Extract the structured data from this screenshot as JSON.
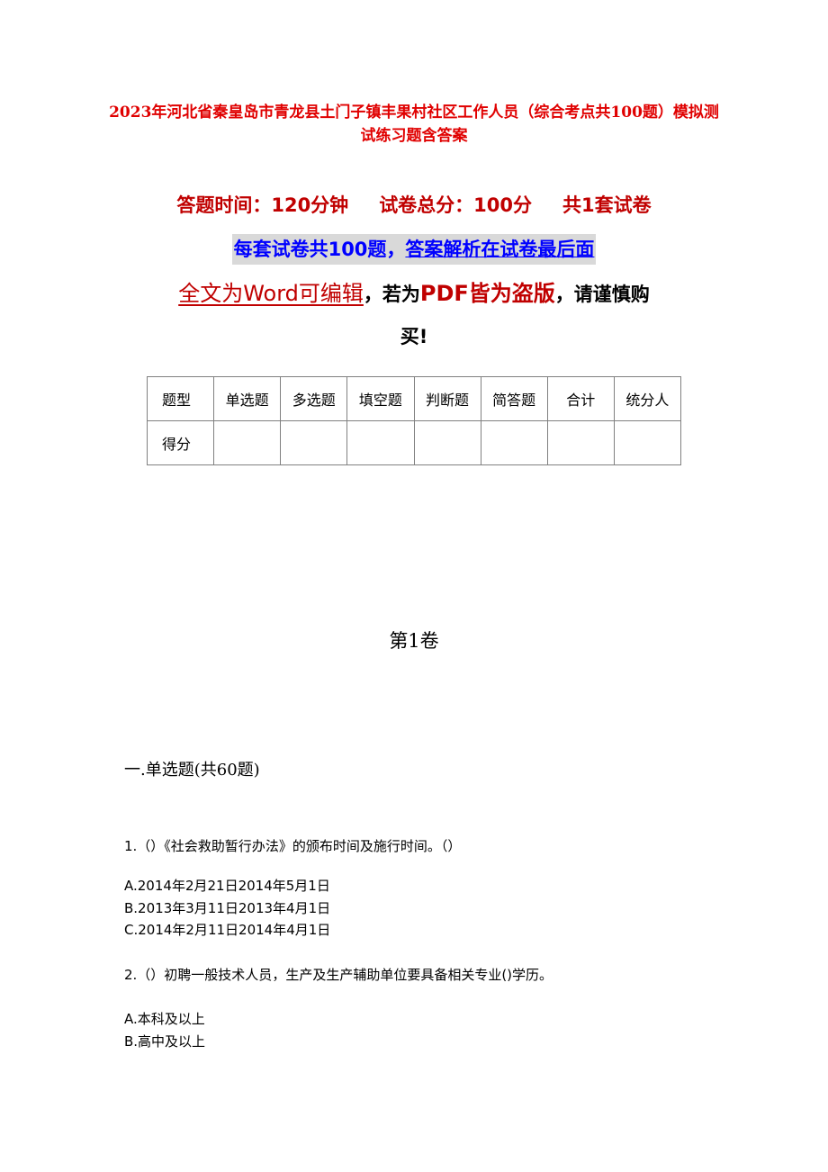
{
  "document": {
    "title": "2023年河北省秦皇岛市青龙县土门子镇丰果村社区工作人员（综合考点共100题）模拟测试练习题含答案",
    "meta": {
      "time_label": "答题时间：120分钟",
      "total_label": "试卷总分：100分",
      "sets_label": "共1套试卷"
    },
    "promo": {
      "part1": "每套试卷共100题，",
      "part2": "答案解析在试卷最后面"
    },
    "warning": {
      "part1": "全文为Word可编辑",
      "part2": "，若为",
      "part3": "PDF皆为盗版",
      "part4": "，请谨慎购",
      "part5": "买!"
    },
    "score_table": {
      "header": [
        "题型",
        "单选题",
        "多选题",
        "填空题",
        "判断题",
        "简答题",
        "合计",
        "统分人"
      ],
      "row": [
        "得分",
        "",
        "",
        "",
        "",
        "",
        "",
        ""
      ]
    },
    "volume_title": "第1卷",
    "section_title": "一.单选题(共60题)",
    "questions": [
      {
        "text": "1.（）《社会救助暂行办法》的颁布时间及施行时间。（）",
        "options": [
          "A.2014年2月21日2014年5月1日",
          "B.2013年3月11日2013年4月1日",
          "C.2014年2月11日2014年4月1日"
        ]
      },
      {
        "text": "2.（）初聘一般技术人员，生产及生产辅助单位要具备相关专业()学历。",
        "options": [
          "A.本科及以上",
          "B.高中及以上"
        ]
      }
    ]
  }
}
